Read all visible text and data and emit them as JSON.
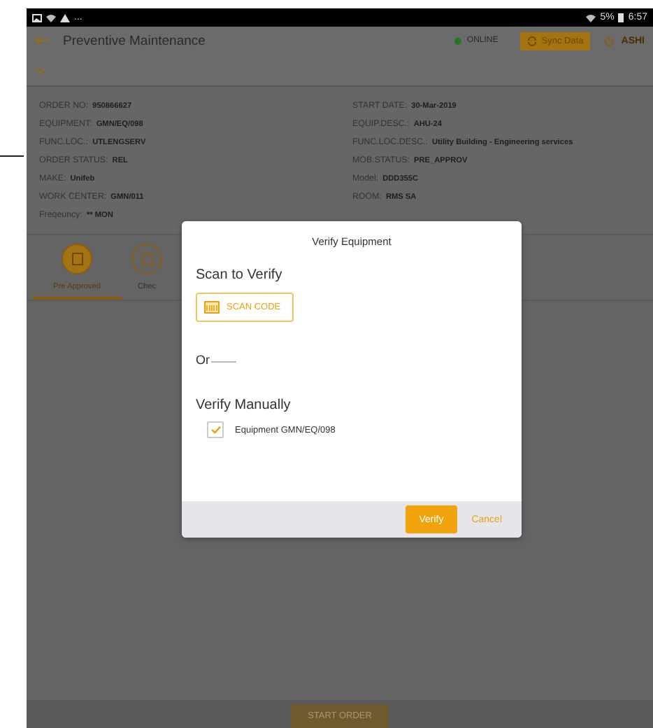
{
  "status_bar": {
    "notifications": "...",
    "battery": "5%",
    "time": "6:57"
  },
  "app_bar": {
    "title": "Preventive Maintenance",
    "connection": {
      "label": "ONLINE",
      "online": true
    },
    "sync_button": "Sync Data",
    "user": "ASHI"
  },
  "details": {
    "left": [
      {
        "label": "ORDER NO:",
        "value": "950866627"
      },
      {
        "label": "EQUIPMENT:",
        "value": "GMN/EQ/098"
      },
      {
        "label": "FUNC.LOC.:",
        "value": "UTLENGSERV"
      },
      {
        "label": "ORDER STATUS:",
        "value": "REL"
      },
      {
        "label": "MAKE:",
        "value": "Unifeb"
      },
      {
        "label": "WORK CENTER:",
        "value": "GMN/011"
      },
      {
        "label": "Freqeuncy:",
        "value": "** MON"
      }
    ],
    "right": [
      {
        "label": "START DATE:",
        "value": "30-Mar-2019"
      },
      {
        "label": "EQUIP.DESC.:",
        "value": "AHU-24"
      },
      {
        "label": "FUNC.LOC.DESC.:",
        "value": "Utility Building - Engineering services"
      },
      {
        "label": "MOB.STATUS:",
        "value": "PRE_APPROV"
      },
      {
        "label": "Model:",
        "value": "DDD355C"
      },
      {
        "label": "ROOM:",
        "value": "RMS SA"
      }
    ]
  },
  "tabs": [
    {
      "label": "Pre Approved",
      "selected": true
    },
    {
      "label": "Chec",
      "selected": false
    }
  ],
  "footer_button": "START ORDER",
  "dialog": {
    "title": "Verify Equipment",
    "scan_heading": "Scan to Verify",
    "scan_button": "SCAN CODE",
    "divider_label": "Or",
    "manual_heading": "Verify Manually",
    "items": [
      {
        "label": "Equipment GMN/EQ/098",
        "checked": true
      }
    ],
    "buttons": [
      {
        "label": "Verify",
        "kind": "primary"
      },
      {
        "label": "Cancel",
        "kind": "text"
      }
    ]
  }
}
